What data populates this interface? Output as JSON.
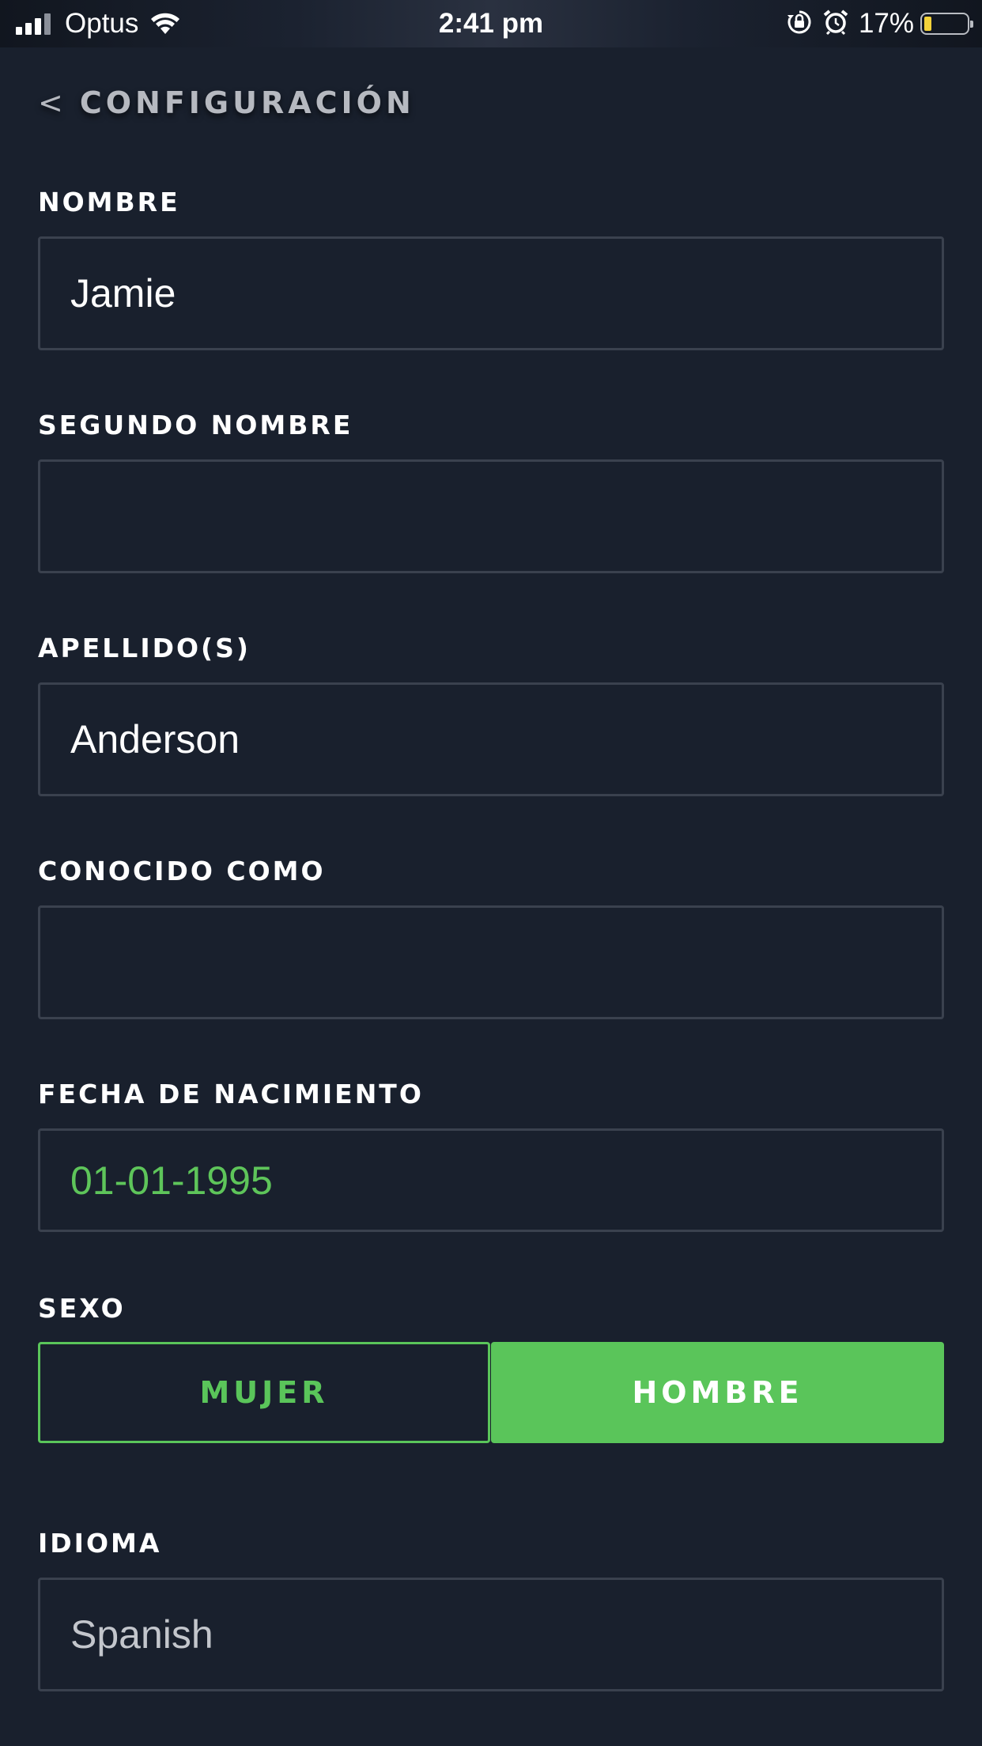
{
  "status_bar": {
    "carrier": "Optus",
    "time": "2:41 pm",
    "battery_percent": "17%",
    "battery_level": 0.17,
    "icons": [
      "signal-icon",
      "wifi-icon",
      "orientation-lock-icon",
      "alarm-icon",
      "battery-icon"
    ]
  },
  "header": {
    "back_chevron": "<",
    "title": "CONFIGURACIÓN"
  },
  "form": {
    "nombre": {
      "label": "NOMBRE",
      "value": "Jamie"
    },
    "segundo_nombre": {
      "label": "SEGUNDO NOMBRE",
      "value": ""
    },
    "apellidos": {
      "label": "APELLIDO(S)",
      "value": "Anderson"
    },
    "conocido_como": {
      "label": "CONOCIDO COMO",
      "value": ""
    },
    "fecha_nacimiento": {
      "label": "FECHA DE NACIMIENTO",
      "value": "01-01-1995"
    },
    "sexo": {
      "label": "SEXO",
      "options": [
        "MUJER",
        "HOMBRE"
      ],
      "selected": "HOMBRE"
    },
    "idioma": {
      "label": "IDIOMA",
      "value": "Spanish"
    }
  },
  "colors": {
    "background": "#19202d",
    "accent_green": "#5ac55a",
    "field_border": "#3a414e"
  }
}
